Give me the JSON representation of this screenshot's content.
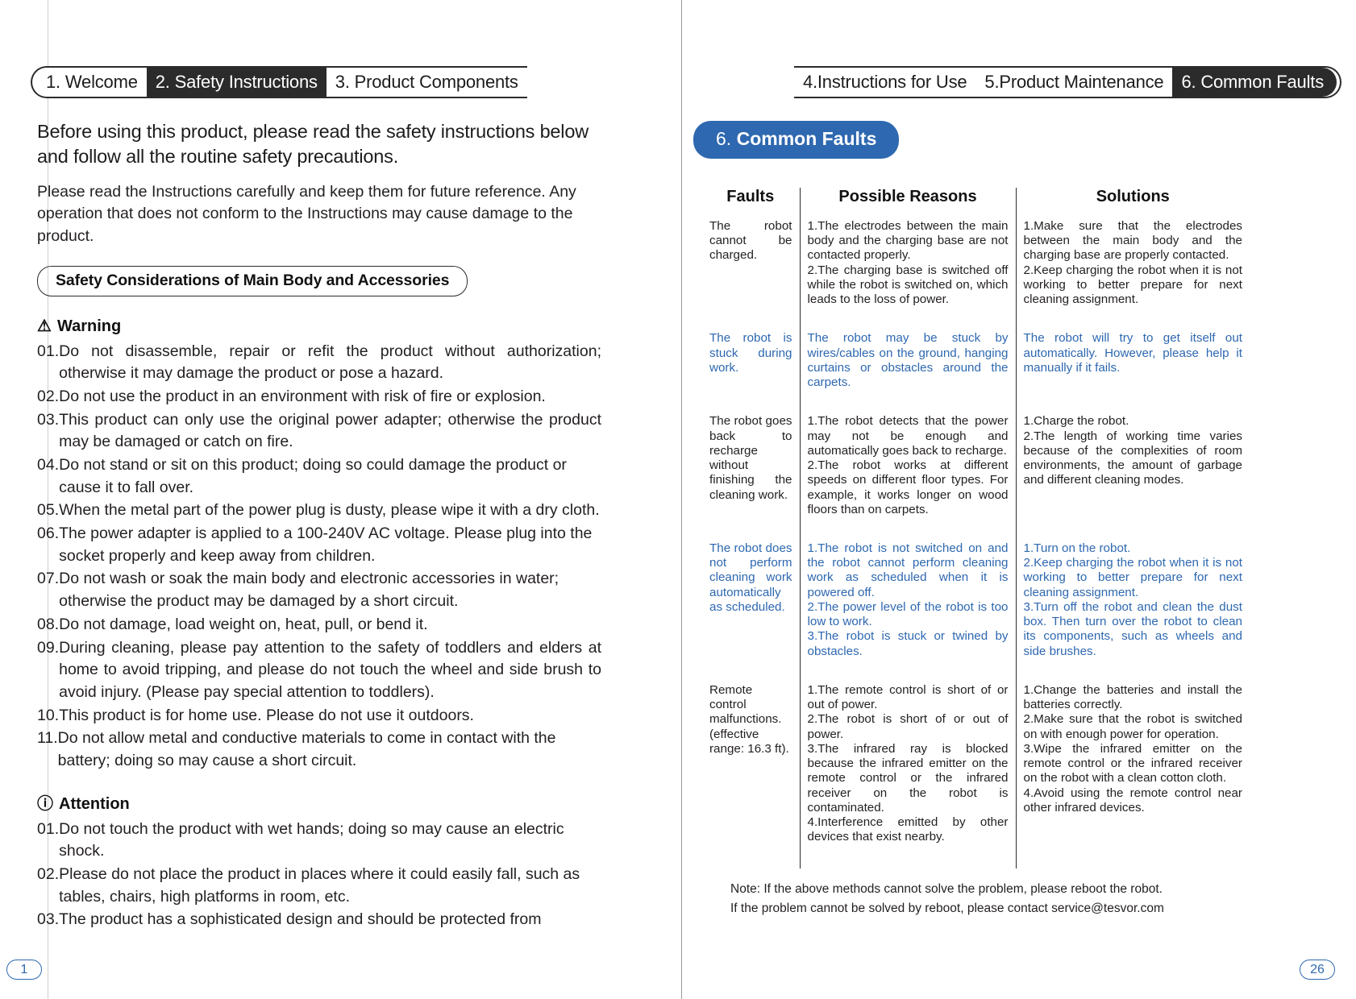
{
  "tabs": {
    "left": [
      {
        "label": "1.  Welcome",
        "active": false
      },
      {
        "label": "2. Safety Instructions",
        "active": true
      },
      {
        "label": "3. Product Components",
        "active": false
      }
    ],
    "right": [
      {
        "label": "4.Instructions for Use",
        "active": false
      },
      {
        "label": "5.Product Maintenance",
        "active": false
      },
      {
        "label": "6. Common Faults",
        "active": true
      }
    ]
  },
  "left_page": {
    "lead": "Before using this product, please read the safety instructions below and follow all the routine safety precautions.",
    "subtext": "Please read the Instructions carefully and keep them for future reference. Any operation that does not conform to the Instructions may cause damage to the product.",
    "pill_heading": "Safety Considerations of Main Body and Accessories",
    "warning": {
      "icon": "warning-triangle-icon",
      "title": "Warning",
      "items": [
        {
          "num": "01.",
          "text": "Do not disassemble, repair or refit the product without authorization; otherwise it may damage the product or pose a hazard."
        },
        {
          "num": "02.",
          "text": "Do not use the product in an environment with risk of fire or explosion."
        },
        {
          "num": "03.",
          "text": "This product can only use the original power adapter; otherwise the product may be damaged or catch on fire."
        },
        {
          "num": "04.",
          "text": "Do not stand or sit on this product; doing so could damage the product or cause it to fall over."
        },
        {
          "num": "05.",
          "text": "When the metal part of the power plug is dusty, please wipe it with a dry cloth."
        },
        {
          "num": "06.",
          "text": "The power adapter is applied to a 100-240V AC voltage. Please plug into the socket properly and keep away from children."
        },
        {
          "num": "07.",
          "text": "Do not wash or soak the main body and electronic accessories in water; otherwise the product may be damaged by a short circuit."
        },
        {
          "num": "08.",
          "text": "Do not damage, load weight on, heat, pull, or bend it."
        },
        {
          "num": "09.",
          "text": "During cleaning, please pay attention to the safety of toddlers and elders at home to avoid tripping, and please do not touch the wheel and side brush to avoid injury. (Please pay special attention to toddlers)."
        },
        {
          "num": "10.",
          "text": "This product is for home use. Please do not use it outdoors."
        },
        {
          "num": "11.",
          "text": "Do not allow metal and conductive materials to come in contact with the battery; doing so may cause a short circuit."
        }
      ]
    },
    "attention": {
      "icon": "exclamation-circle-icon",
      "title": "Attention",
      "items": [
        {
          "num": "01.",
          "text": "Do not touch the product with wet hands; doing so may cause an electric shock."
        },
        {
          "num": "02.",
          "text": "Please do not place the product in places where it could easily fall, such as tables, chairs, high platforms in room, etc."
        },
        {
          "num": "03.",
          "text": "The product has a sophisticated design and should be protected from"
        }
      ]
    },
    "page_number": "1"
  },
  "right_page": {
    "section_pill": {
      "number": "6.",
      "title": " Common Faults"
    },
    "table": {
      "headers": [
        "Faults",
        "Possible Reasons",
        "Solutions"
      ],
      "rows": [
        {
          "highlight": false,
          "fault": "The robot cannot be charged.",
          "reasons": [
            "1.The electrodes between the main body and the charging base are not contacted properly.",
            "2.The charging base is switched off while the robot is switched on, which leads to the loss of power."
          ],
          "solutions": [
            "1.Make sure that the electrodes between the main body and the charging base are properly contacted.",
            "2.Keep charging the robot when it is not working to better prepare for next cleaning assignment."
          ]
        },
        {
          "highlight": true,
          "fault": "The robot is stuck during work.",
          "reasons": [
            "The robot may be stuck by wires/cables on the ground, hanging curtains or obstacles around the carpets."
          ],
          "solutions": [
            "The robot will try to get itself out automatically. However, please help it manually if it fails."
          ]
        },
        {
          "highlight": false,
          "fault": "The robot goes back to recharge without finishing the cleaning work.",
          "reasons": [
            "1.The robot detects that the power may not be enough and automatically goes back to recharge.",
            "2.The robot works at different speeds on different floor types. For example, it works longer on wood floors than on carpets."
          ],
          "solutions": [
            "1.Charge the robot.",
            "2.The length of working time varies because of the complexities of room environments, the amount of garbage and different cleaning modes."
          ]
        },
        {
          "highlight": true,
          "fault": "The robot does not perform cleaning work automatically as scheduled.",
          "reasons": [
            "1.The robot is not switched on and the robot cannot perform cleaning work as scheduled when it is powered off.",
            "2.The power level of the robot is too low to work.",
            "3.The robot is stuck or twined by obstacles."
          ],
          "solutions": [
            "1.Turn on the robot.",
            "2.Keep charging the robot when it is not working to better prepare for next cleaning assignment.",
            "3.Turn off the robot and clean the dust box. Then turn over the robot to clean its components, such as wheels and side brushes."
          ]
        },
        {
          "highlight": false,
          "fault": "Remote control malfunctions. (effective range: 16.3 ft).",
          "reasons": [
            "1.The remote control is short of or out of power.",
            "2.The robot is short of or out of power.",
            "3.The infrared ray is blocked because the infrared emitter on the remote control or the infrared receiver on the robot is contaminated.",
            "4.Interference emitted by other devices that exist nearby."
          ],
          "solutions": [
            "1.Change the batteries and install the batteries correctly.",
            "2.Make sure that the robot is switched on with enough power for operation.",
            "3.Wipe the infrared emitter on the remote control or the infrared receiver on the robot with a clean cotton cloth.",
            "4.Avoid using the remote control near other infrared devices."
          ]
        }
      ]
    },
    "note_line1": "Note: If the above methods cannot solve the problem, please reboot the robot.",
    "note_line2": "If the problem cannot be solved by reboot, please contact service@tesvor.com",
    "page_number": "26"
  },
  "colors": {
    "accent_blue": "#2e68b0",
    "tab_active_bg": "#2b2b2b",
    "ink": "#231f20"
  }
}
